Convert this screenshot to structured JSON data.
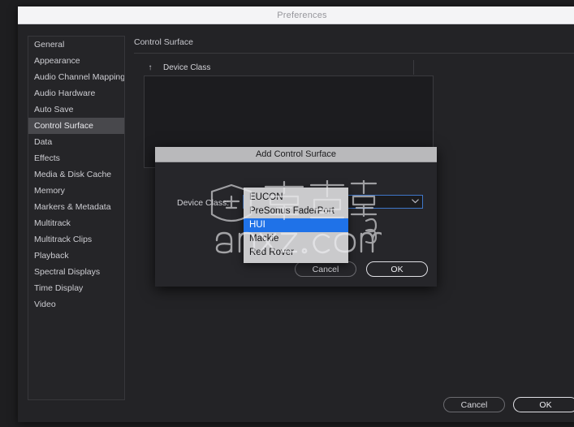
{
  "window": {
    "title": "Preferences"
  },
  "sidebar": {
    "items": [
      {
        "label": "General",
        "selected": false
      },
      {
        "label": "Appearance",
        "selected": false
      },
      {
        "label": "Audio Channel Mapping",
        "selected": false
      },
      {
        "label": "Audio Hardware",
        "selected": false
      },
      {
        "label": "Auto Save",
        "selected": false
      },
      {
        "label": "Control Surface",
        "selected": true
      },
      {
        "label": "Data",
        "selected": false
      },
      {
        "label": "Effects",
        "selected": false
      },
      {
        "label": "Media & Disk Cache",
        "selected": false
      },
      {
        "label": "Memory",
        "selected": false
      },
      {
        "label": "Markers & Metadata",
        "selected": false
      },
      {
        "label": "Multitrack",
        "selected": false
      },
      {
        "label": "Multitrack Clips",
        "selected": false
      },
      {
        "label": "Playback",
        "selected": false
      },
      {
        "label": "Spectral Displays",
        "selected": false
      },
      {
        "label": "Time Display",
        "selected": false
      },
      {
        "label": "Video",
        "selected": false
      }
    ]
  },
  "pane": {
    "heading": "Control Surface",
    "table": {
      "sort_icon": "sort-ascending-arrow-icon",
      "sort_glyph": "↑",
      "columns": [
        "Device Class"
      ],
      "rows": []
    }
  },
  "footer": {
    "cancel_label": "Cancel",
    "ok_label": "OK"
  },
  "dialog": {
    "title": "Add Control Surface",
    "device_class_label": "Device Class:",
    "device_class_value": "",
    "chevron_icon": "chevron-down-icon",
    "chevron_glyph": "⌄",
    "cancel_label": "Cancel",
    "ok_label": "OK",
    "dropdown": {
      "open": true,
      "options": [
        {
          "label": "EUCON",
          "selected": false
        },
        {
          "label": "PreSonus FaderPort",
          "selected": false
        },
        {
          "label": "HUI",
          "selected": true
        },
        {
          "label": "Mackie",
          "selected": false
        },
        {
          "label": "Red Rover",
          "selected": false
        }
      ]
    }
  },
  "watermark": {
    "text_cn": "安下载",
    "text_url": "anxz.com"
  },
  "colors": {
    "window_bg": "#232326",
    "titlebar_bg": "#f4f4f6",
    "sidebar_selected": "#48484c",
    "dialog_titlebar": "#b9b9bb",
    "dropdown_bg": "#cacacc",
    "dropdown_highlight": "#1f72e8",
    "focus_border": "#3f76c8"
  }
}
